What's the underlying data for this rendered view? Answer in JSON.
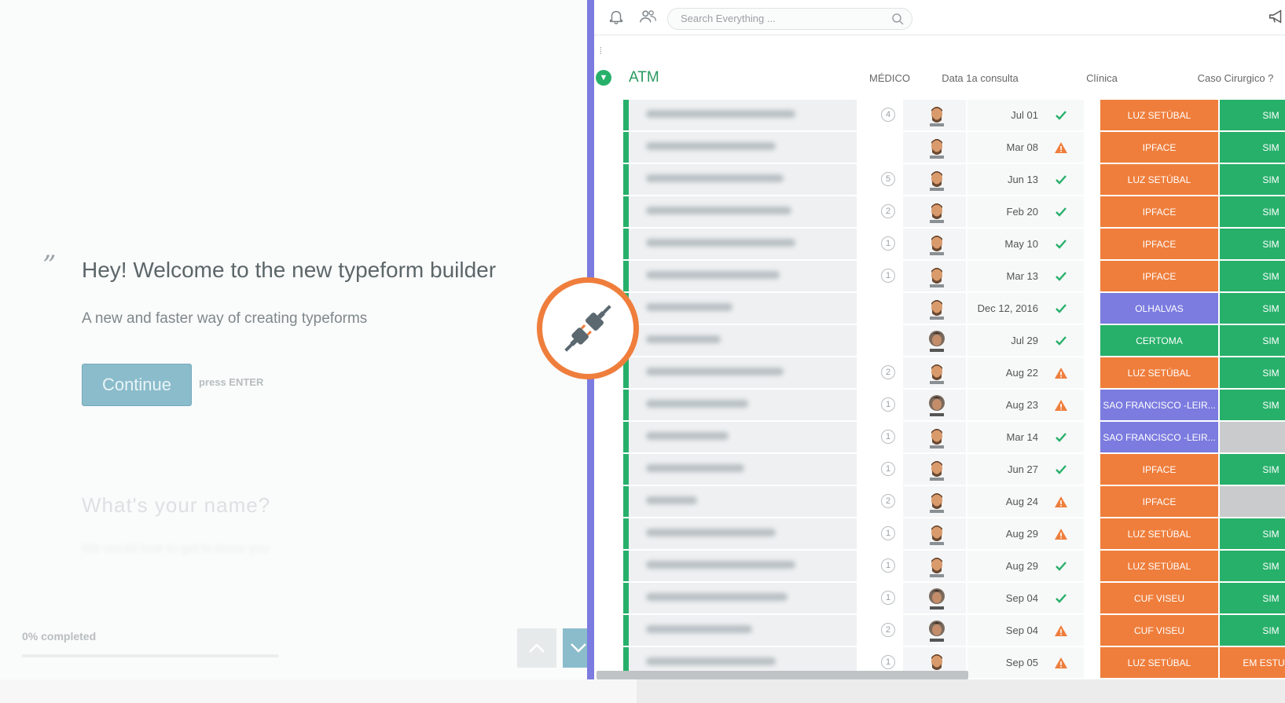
{
  "typeform": {
    "quote_mark": "”",
    "title": "Hey! Welcome to the new typeform builder",
    "subtitle": "A new and faster way of creating typeforms",
    "continue_label": "Continue",
    "continue_hint": "press ENTER",
    "next_question": "What's your name?",
    "next_question_hint": "We would love to get to know you",
    "progress_label": "0% completed",
    "progress": 0
  },
  "board": {
    "search_placeholder": "Search Everything ...",
    "group_name": "ATM",
    "columns": {
      "medico": "MÉDICO",
      "data": "Data 1a consulta",
      "clinica": "Clínica",
      "caso": "Caso Cirurgico ?"
    },
    "colors": {
      "luz": "#ef7e3c",
      "ipface": "#ef7e3c",
      "olhalvas": "#7b7be0",
      "certoma": "#27b06a",
      "sao": "#7b7be0",
      "cuf": "#ef7e3c",
      "sim": "#27b06a",
      "estudo": "#ef7e3c",
      "empty": "#c9cbcc"
    },
    "rows": [
      {
        "updates": "4",
        "avatar": "a",
        "date": "Jul 01",
        "status": "done",
        "clinica": "LUZ SETÚBAL",
        "clinica_color": "#ef7e3c",
        "caso": "SIM",
        "caso_color": "#27b06a"
      },
      {
        "updates": "",
        "avatar": "a",
        "date": "Mar 08",
        "status": "warn",
        "clinica": "IPFACE",
        "clinica_color": "#ef7e3c",
        "caso": "SIM",
        "caso_color": "#27b06a"
      },
      {
        "updates": "5",
        "avatar": "a",
        "date": "Jun 13",
        "status": "done",
        "clinica": "LUZ SETÚBAL",
        "clinica_color": "#ef7e3c",
        "caso": "SIM",
        "caso_color": "#27b06a"
      },
      {
        "updates": "2",
        "avatar": "a",
        "date": "Feb 20",
        "status": "done",
        "clinica": "IPFACE",
        "clinica_color": "#ef7e3c",
        "caso": "SIM",
        "caso_color": "#27b06a"
      },
      {
        "updates": "1",
        "avatar": "a",
        "date": "May 10",
        "status": "done",
        "clinica": "IPFACE",
        "clinica_color": "#ef7e3c",
        "caso": "SIM",
        "caso_color": "#27b06a"
      },
      {
        "updates": "1",
        "avatar": "a",
        "date": "Mar 13",
        "status": "done",
        "clinica": "IPFACE",
        "clinica_color": "#ef7e3c",
        "caso": "SIM",
        "caso_color": "#27b06a"
      },
      {
        "updates": "",
        "avatar": "a",
        "date": "Dec 12, 2016",
        "status": "done",
        "clinica": "OLHALVAS",
        "clinica_color": "#7b7be0",
        "caso": "SIM",
        "caso_color": "#27b06a"
      },
      {
        "updates": "",
        "avatar": "b",
        "date": "Jul 29",
        "status": "done",
        "clinica": "CERTOMA",
        "clinica_color": "#27b06a",
        "caso": "SIM",
        "caso_color": "#27b06a"
      },
      {
        "updates": "2",
        "avatar": "a",
        "date": "Aug 22",
        "status": "warn",
        "clinica": "LUZ SETÚBAL",
        "clinica_color": "#ef7e3c",
        "caso": "SIM",
        "caso_color": "#27b06a"
      },
      {
        "updates": "1",
        "avatar": "b",
        "date": "Aug 23",
        "status": "warn",
        "clinica": "SAO FRANCISCO -LEIR...",
        "clinica_color": "#7b7be0",
        "caso": "SIM",
        "caso_color": "#27b06a"
      },
      {
        "updates": "1",
        "avatar": "a",
        "date": "Mar 14",
        "status": "done",
        "clinica": "SAO FRANCISCO -LEIR...",
        "clinica_color": "#7b7be0",
        "caso": "",
        "caso_color": "#c9cbcc"
      },
      {
        "updates": "1",
        "avatar": "a",
        "date": "Jun 27",
        "status": "done",
        "clinica": "IPFACE",
        "clinica_color": "#ef7e3c",
        "caso": "SIM",
        "caso_color": "#27b06a"
      },
      {
        "updates": "2",
        "avatar": "a",
        "date": "Aug 24",
        "status": "warn",
        "clinica": "IPFACE",
        "clinica_color": "#ef7e3c",
        "caso": "",
        "caso_color": "#c9cbcc"
      },
      {
        "updates": "1",
        "avatar": "a",
        "date": "Aug 29",
        "status": "warn",
        "clinica": "LUZ SETÚBAL",
        "clinica_color": "#ef7e3c",
        "caso": "SIM",
        "caso_color": "#27b06a"
      },
      {
        "updates": "1",
        "avatar": "a",
        "date": "Aug 29",
        "status": "done",
        "clinica": "LUZ SETÚBAL",
        "clinica_color": "#ef7e3c",
        "caso": "SIM",
        "caso_color": "#27b06a"
      },
      {
        "updates": "1",
        "avatar": "b",
        "date": "Sep 04",
        "status": "done",
        "clinica": "CUF VISEU",
        "clinica_color": "#ef7e3c",
        "caso": "SIM",
        "caso_color": "#27b06a"
      },
      {
        "updates": "2",
        "avatar": "b",
        "date": "Sep 04",
        "status": "warn",
        "clinica": "CUF VISEU",
        "clinica_color": "#ef7e3c",
        "caso": "SIM",
        "caso_color": "#27b06a"
      },
      {
        "updates": "1",
        "avatar": "a",
        "date": "Sep 05",
        "status": "warn",
        "clinica": "LUZ SETÚBAL",
        "clinica_color": "#ef7e3c",
        "caso": "EM ESTUDO",
        "caso_color": "#ef7e3c"
      }
    ]
  }
}
